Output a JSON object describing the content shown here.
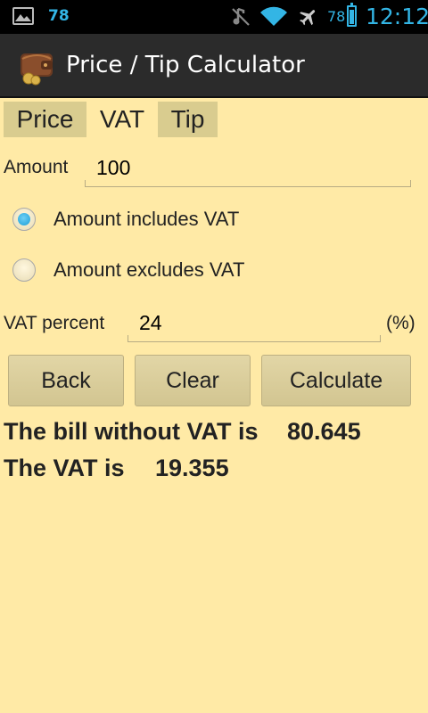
{
  "status_bar": {
    "notification_count": "78",
    "battery_percent": "78",
    "battery_level": 0.78,
    "time": "12:12",
    "icons": [
      "gallery-icon",
      "mute-icon",
      "wifi-icon",
      "airplane-icon",
      "battery-icon"
    ]
  },
  "action_bar": {
    "title": "Price / Tip Calculator",
    "icon": "wallet-icon"
  },
  "tabs": [
    {
      "label": "Price",
      "active": false
    },
    {
      "label": "VAT",
      "active": true
    },
    {
      "label": "Tip",
      "active": false
    }
  ],
  "form": {
    "amount_label": "Amount",
    "amount_value": "100",
    "radio_includes_label": "Amount includes VAT",
    "radio_excludes_label": "Amount excludes VAT",
    "selected_option": "includes",
    "vat_percent_label": "VAT percent",
    "vat_percent_value": "24",
    "vat_percent_unit": "(%)"
  },
  "buttons": {
    "back": "Back",
    "clear": "Clear",
    "calculate": "Calculate"
  },
  "results": {
    "without_vat_label": "The bill without VAT is",
    "without_vat_value": "80.645",
    "vat_label": "The VAT is",
    "vat_value": "19.355"
  },
  "colors": {
    "background": "#ffeaa6",
    "accent": "#33b5e5",
    "action_bar": "#2b2b2b",
    "inactive_tab": "#d9cc8f"
  }
}
